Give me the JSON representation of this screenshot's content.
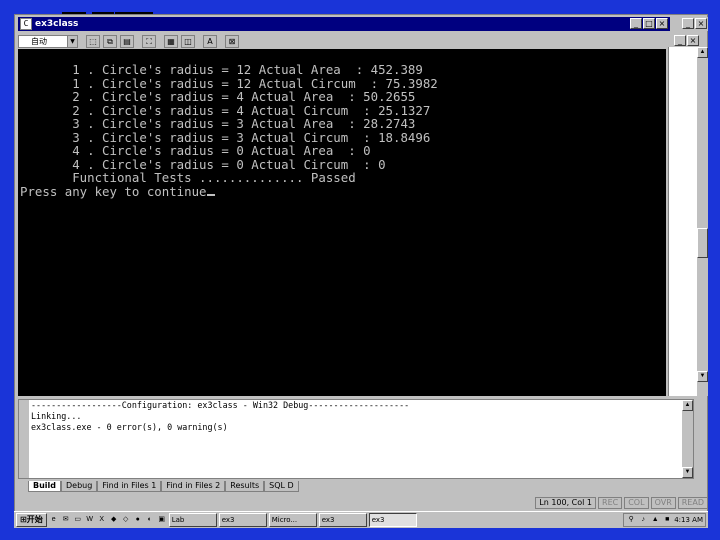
{
  "window": {
    "title": "ex3class"
  },
  "toolbar": {
    "font_select_value": "自动"
  },
  "console": {
    "lines": [
      "       1 . Circle's radius = 12 Actual Area  : 452.389",
      "       1 . Circle's radius = 12 Actual Circum  : 75.3982",
      "       2 . Circle's radius = 4 Actual Area  : 50.2655",
      "       2 . Circle's radius = 4 Actual Circum  : 25.1327",
      "       3 . Circle's radius = 3 Actual Area  : 28.2743",
      "       3 . Circle's radius = 3 Actual Circum  : 18.8496",
      "       4 . Circle's radius = 0 Actual Area  : 0",
      "       4 . Circle's radius = 0 Actual Circum  : 0",
      "       Functional Tests .............. Passed",
      "Press any key to continue"
    ]
  },
  "output": {
    "lines": [
      "------------------Configuration: ex3class - Win32 Debug--------------------",
      "Linking...",
      "",
      "ex3class.exe - 0 error(s), 0 warning(s)"
    ]
  },
  "tabs": [
    {
      "label": "Build"
    },
    {
      "label": "Debug"
    },
    {
      "label": "Find in Files 1"
    },
    {
      "label": "Find in Files 2"
    },
    {
      "label": "Results"
    },
    {
      "label": "SQL D"
    }
  ],
  "statusbar": {
    "position": "Ln 100, Col 1",
    "rec": "REC",
    "col": "COL",
    "ovr": "OVR",
    "read": "READ"
  },
  "taskbar": {
    "start_label": "开始",
    "tasks": [
      {
        "label": "Lab"
      },
      {
        "label": "ex3"
      },
      {
        "label": "Micro..."
      },
      {
        "label": "ex3"
      },
      {
        "label": "ex3"
      }
    ],
    "clock": "4:13 AM"
  }
}
